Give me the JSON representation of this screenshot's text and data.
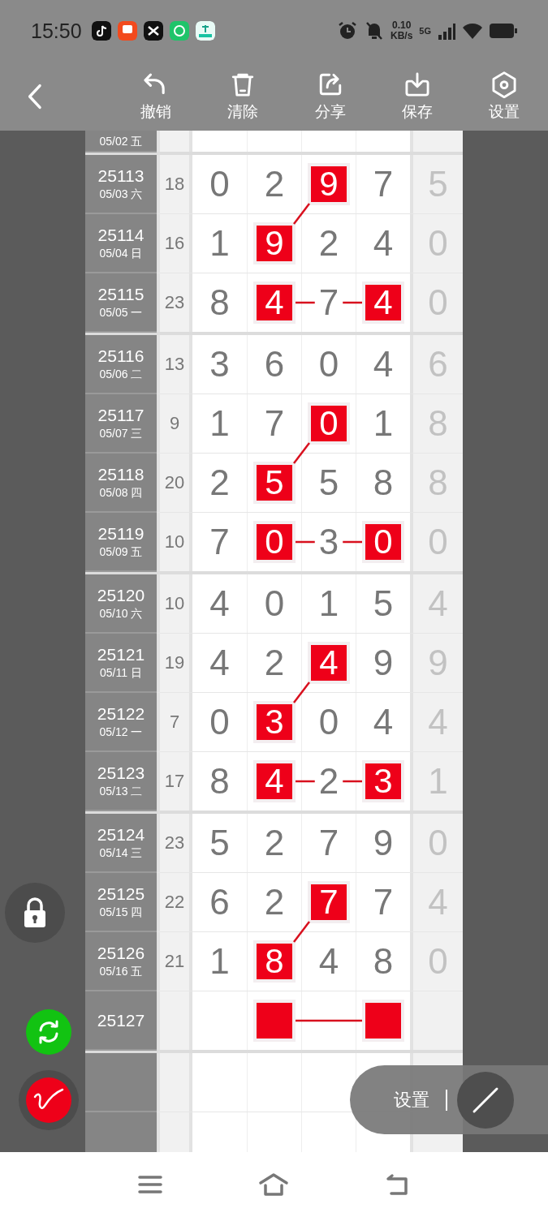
{
  "status_bar": {
    "time": "15:50",
    "speed_value": "0.10",
    "speed_unit": "KB/s",
    "network": "5G"
  },
  "toolbar": {
    "actions": [
      {
        "label": "撤销"
      },
      {
        "label": "清除"
      },
      {
        "label": "分享"
      },
      {
        "label": "保存"
      },
      {
        "label": "设置"
      }
    ]
  },
  "chart": {
    "groups": [
      {
        "rows": [
          {
            "date": "05/02 五"
          }
        ]
      },
      {
        "rows": [
          {
            "period": "25113",
            "date": "05/03 六",
            "sum": "18",
            "digits": [
              {
                "value": "0",
                "marked": false
              },
              {
                "value": "2",
                "marked": false
              },
              {
                "value": "9",
                "marked": true
              },
              {
                "value": "7",
                "marked": false
              }
            ],
            "extra": "5"
          },
          {
            "period": "25114",
            "date": "05/04 日",
            "sum": "16",
            "digits": [
              {
                "value": "1",
                "marked": false
              },
              {
                "value": "9",
                "marked": true
              },
              {
                "value": "2",
                "marked": false
              },
              {
                "value": "4",
                "marked": false
              }
            ],
            "extra": "0"
          },
          {
            "period": "25115",
            "date": "05/05 一",
            "sum": "23",
            "digits": [
              {
                "value": "8",
                "marked": false
              },
              {
                "value": "4",
                "marked": true
              },
              {
                "value": "7",
                "marked": false
              },
              {
                "value": "4",
                "marked": true
              }
            ],
            "extra": "0"
          }
        ]
      },
      {
        "rows": [
          {
            "period": "25116",
            "date": "05/06 二",
            "sum": "13",
            "digits": [
              {
                "value": "3",
                "marked": false
              },
              {
                "value": "6",
                "marked": false
              },
              {
                "value": "0",
                "marked": false
              },
              {
                "value": "4",
                "marked": false
              }
            ],
            "extra": "6"
          },
          {
            "period": "25117",
            "date": "05/07 三",
            "sum": "9",
            "digits": [
              {
                "value": "1",
                "marked": false
              },
              {
                "value": "7",
                "marked": false
              },
              {
                "value": "0",
                "marked": true
              },
              {
                "value": "1",
                "marked": false
              }
            ],
            "extra": "8"
          },
          {
            "period": "25118",
            "date": "05/08 四",
            "sum": "20",
            "digits": [
              {
                "value": "2",
                "marked": false
              },
              {
                "value": "5",
                "marked": true
              },
              {
                "value": "5",
                "marked": false
              },
              {
                "value": "8",
                "marked": false
              }
            ],
            "extra": "8"
          },
          {
            "period": "25119",
            "date": "05/09 五",
            "sum": "10",
            "digits": [
              {
                "value": "7",
                "marked": false
              },
              {
                "value": "0",
                "marked": true
              },
              {
                "value": "3",
                "marked": false
              },
              {
                "value": "0",
                "marked": true
              }
            ],
            "extra": "0"
          }
        ]
      },
      {
        "rows": [
          {
            "period": "25120",
            "date": "05/10 六",
            "sum": "10",
            "digits": [
              {
                "value": "4",
                "marked": false
              },
              {
                "value": "0",
                "marked": false
              },
              {
                "value": "1",
                "marked": false
              },
              {
                "value": "5",
                "marked": false
              }
            ],
            "extra": "4"
          },
          {
            "period": "25121",
            "date": "05/11 日",
            "sum": "19",
            "digits": [
              {
                "value": "4",
                "marked": false
              },
              {
                "value": "2",
                "marked": false
              },
              {
                "value": "4",
                "marked": true
              },
              {
                "value": "9",
                "marked": false
              }
            ],
            "extra": "9"
          },
          {
            "period": "25122",
            "date": "05/12 一",
            "sum": "7",
            "digits": [
              {
                "value": "0",
                "marked": false
              },
              {
                "value": "3",
                "marked": true
              },
              {
                "value": "0",
                "marked": false
              },
              {
                "value": "4",
                "marked": false
              }
            ],
            "extra": "4"
          },
          {
            "period": "25123",
            "date": "05/13 二",
            "sum": "17",
            "digits": [
              {
                "value": "8",
                "marked": false
              },
              {
                "value": "4",
                "marked": true
              },
              {
                "value": "2",
                "marked": false
              },
              {
                "value": "3",
                "marked": true
              }
            ],
            "extra": "1"
          }
        ]
      },
      {
        "rows": [
          {
            "period": "25124",
            "date": "05/14 三",
            "sum": "23",
            "digits": [
              {
                "value": "5",
                "marked": false
              },
              {
                "value": "2",
                "marked": false
              },
              {
                "value": "7",
                "marked": false
              },
              {
                "value": "9",
                "marked": false
              }
            ],
            "extra": "0"
          },
          {
            "period": "25125",
            "date": "05/15 四",
            "sum": "22",
            "digits": [
              {
                "value": "6",
                "marked": false
              },
              {
                "value": "2",
                "marked": false
              },
              {
                "value": "7",
                "marked": true
              },
              {
                "value": "7",
                "marked": false
              }
            ],
            "extra": "4"
          },
          {
            "period": "25126",
            "date": "05/16 五",
            "sum": "21",
            "digits": [
              {
                "value": "1",
                "marked": false
              },
              {
                "value": "8",
                "marked": true
              },
              {
                "value": "4",
                "marked": false
              },
              {
                "value": "8",
                "marked": false
              }
            ],
            "extra": "0"
          },
          {
            "period": "25127",
            "digits": [
              {
                "marked": false
              },
              {
                "marked": true
              },
              {
                "marked": false
              },
              {
                "marked": true
              }
            ]
          }
        ]
      }
    ]
  },
  "pen_menu": {
    "label": "设置"
  }
}
